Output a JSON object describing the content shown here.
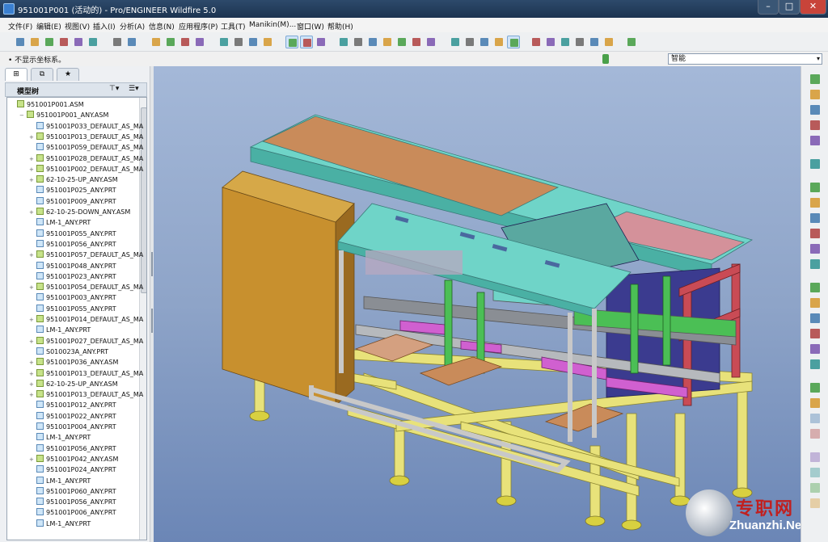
{
  "window": {
    "title": "951001P001 (活动的) - Pro/ENGINEER Wildfire 5.0",
    "minimize": "–",
    "maximize": "□",
    "close": "✕"
  },
  "menu": [
    "文件(F)",
    "编辑(E)",
    "视图(V)",
    "插入(I)",
    "分析(A)",
    "信息(N)",
    "应用程序(P)",
    "工具(T)",
    "Manikin(M)...",
    "窗口(W)",
    "帮助(H)"
  ],
  "message": "• 不显示坐标系。",
  "filter": {
    "selected": "智能",
    "arrow": "▾"
  },
  "panel": {
    "tabs": [
      "⊞",
      "⧉",
      "★"
    ],
    "tree_title": "模型树",
    "tree_tools": [
      "⊤▾",
      "☰▾"
    ]
  },
  "tree": [
    {
      "label": "951001P001.ASM",
      "type": "asm",
      "indent": 0,
      "expand": ""
    },
    {
      "label": "951001P001_ANY.ASM",
      "type": "asm",
      "indent": 1,
      "expand": "−"
    },
    {
      "label": "951001P033_DEFAULT_AS_MA",
      "type": "prt",
      "indent": 2,
      "expand": ""
    },
    {
      "label": "951001P013_DEFAULT_AS_MA",
      "type": "asm",
      "indent": 2,
      "expand": "+"
    },
    {
      "label": "951001P059_DEFAULT_AS_MA",
      "type": "prt",
      "indent": 2,
      "expand": ""
    },
    {
      "label": "951001P028_DEFAULT_AS_MA",
      "type": "asm",
      "indent": 2,
      "expand": "+"
    },
    {
      "label": "951001P002_DEFAULT_AS_MA",
      "type": "asm",
      "indent": 2,
      "expand": "+"
    },
    {
      "label": "62-10-25-UP_ANY.ASM",
      "type": "asm",
      "indent": 2,
      "expand": "+"
    },
    {
      "label": "951001P025_ANY.PRT",
      "type": "prt",
      "indent": 2,
      "expand": ""
    },
    {
      "label": "951001P009_ANY.PRT",
      "type": "prt",
      "indent": 2,
      "expand": ""
    },
    {
      "label": "62-10-25-DOWN_ANY.ASM",
      "type": "asm",
      "indent": 2,
      "expand": "+"
    },
    {
      "label": "LM-1_ANY.PRT",
      "type": "prt",
      "indent": 2,
      "expand": ""
    },
    {
      "label": "951001P055_ANY.PRT",
      "type": "prt",
      "indent": 2,
      "expand": ""
    },
    {
      "label": "951001P056_ANY.PRT",
      "type": "prt",
      "indent": 2,
      "expand": ""
    },
    {
      "label": "951001P057_DEFAULT_AS_MA",
      "type": "asm",
      "indent": 2,
      "expand": "+"
    },
    {
      "label": "951001P048_ANY.PRT",
      "type": "prt",
      "indent": 2,
      "expand": ""
    },
    {
      "label": "951001P023_ANY.PRT",
      "type": "prt",
      "indent": 2,
      "expand": ""
    },
    {
      "label": "951001P054_DEFAULT_AS_MA",
      "type": "asm",
      "indent": 2,
      "expand": "+"
    },
    {
      "label": "951001P003_ANY.PRT",
      "type": "prt",
      "indent": 2,
      "expand": ""
    },
    {
      "label": "951001P055_ANY.PRT",
      "type": "prt",
      "indent": 2,
      "expand": ""
    },
    {
      "label": "951001P014_DEFAULT_AS_MA",
      "type": "asm",
      "indent": 2,
      "expand": "+"
    },
    {
      "label": "LM-1_ANY.PRT",
      "type": "prt",
      "indent": 2,
      "expand": ""
    },
    {
      "label": "951001P027_DEFAULT_AS_MA",
      "type": "asm",
      "indent": 2,
      "expand": "+"
    },
    {
      "label": "S010023A_ANY.PRT",
      "type": "prt",
      "indent": 2,
      "expand": ""
    },
    {
      "label": "951001P036_ANY.ASM",
      "type": "asm",
      "indent": 2,
      "expand": "+"
    },
    {
      "label": "951001P013_DEFAULT_AS_MA",
      "type": "asm",
      "indent": 2,
      "expand": "+"
    },
    {
      "label": "62-10-25-UP_ANY.ASM",
      "type": "asm",
      "indent": 2,
      "expand": "+"
    },
    {
      "label": "951001P013_DEFAULT_AS_MA",
      "type": "asm",
      "indent": 2,
      "expand": "+"
    },
    {
      "label": "951001P012_ANY.PRT",
      "type": "prt",
      "indent": 2,
      "expand": ""
    },
    {
      "label": "951001P022_ANY.PRT",
      "type": "prt",
      "indent": 2,
      "expand": ""
    },
    {
      "label": "951001P004_ANY.PRT",
      "type": "prt",
      "indent": 2,
      "expand": ""
    },
    {
      "label": "LM-1_ANY.PRT",
      "type": "prt",
      "indent": 2,
      "expand": ""
    },
    {
      "label": "951001P056_ANY.PRT",
      "type": "prt",
      "indent": 2,
      "expand": ""
    },
    {
      "label": "951001P042_ANY.ASM",
      "type": "asm",
      "indent": 2,
      "expand": "+"
    },
    {
      "label": "951001P024_ANY.PRT",
      "type": "prt",
      "indent": 2,
      "expand": ""
    },
    {
      "label": "LM-1_ANY.PRT",
      "type": "prt",
      "indent": 2,
      "expand": ""
    },
    {
      "label": "951001P060_ANY.PRT",
      "type": "prt",
      "indent": 2,
      "expand": ""
    },
    {
      "label": "951001P056_ANY.PRT",
      "type": "prt",
      "indent": 2,
      "expand": ""
    },
    {
      "label": "951001P006_ANY.PRT",
      "type": "prt",
      "indent": 2,
      "expand": ""
    },
    {
      "label": "LM-1_ANY.PRT",
      "type": "prt",
      "indent": 2,
      "expand": ""
    }
  ],
  "toolbar_icons": [
    "new-icon",
    "open-icon",
    "save-icon",
    "save-copy-icon",
    "print-icon",
    "email-icon",
    "copy-icon",
    "undo-icon",
    "redo-icon",
    "cut-icon",
    "copy-icon",
    "paste-icon",
    "paste-special-icon",
    "regenerate-icon",
    "find-icon",
    "select-box-icon",
    "repaint-icon",
    "orient-icon",
    "spin-center-icon",
    "shading-icon",
    "pan-icon",
    "zoom-in-icon",
    "zoom-out-icon",
    "refit-icon",
    "reorient-icon",
    "saved-views-icon",
    "layers-icon",
    "wireframe-icon",
    "hidden-line-icon",
    "no-hidden-icon",
    "shaded-icon",
    "enhanced-realism-icon",
    "datum-planes-icon",
    "datum-axes-icon",
    "datum-points-icon",
    "coordinate-systems-icon",
    "annotations-icon",
    "context-help-icon"
  ],
  "right_icons": [
    "sketch-icon",
    "plane-icon",
    "axis-icon",
    "curve-icon",
    "point-icon",
    "csys-icon",
    "analysis-icon",
    "sketch-tool-icon",
    "extrude-icon",
    "revolve-icon",
    "sweep-icon",
    "blend-icon",
    "hole-icon",
    "round-icon",
    "chamfer-icon",
    "rib-icon",
    "draft-icon",
    "shell-icon",
    "pattern-icon",
    "mirror-icon",
    "merge-icon",
    "trim-icon",
    "offset-icon",
    "thicken-icon",
    "solidify-icon",
    "grid-icon"
  ],
  "colors": {
    "titlebar": "#2d4a6b",
    "viewport_top": "#a4b8d8",
    "viewport_bottom": "#6b86b6",
    "frame_yellow": "#e8e27a",
    "plate_orange": "#c98b5a",
    "plate_cyan": "#6fd4c8",
    "cabinet": "#c8902e",
    "red": "#c94b55",
    "green": "#4bbf55",
    "magenta": "#d060d0",
    "blue": "#3b3b8f"
  },
  "watermark": {
    "text_cn": "专职网",
    "text_en": "Zhuanzhi.Net"
  }
}
